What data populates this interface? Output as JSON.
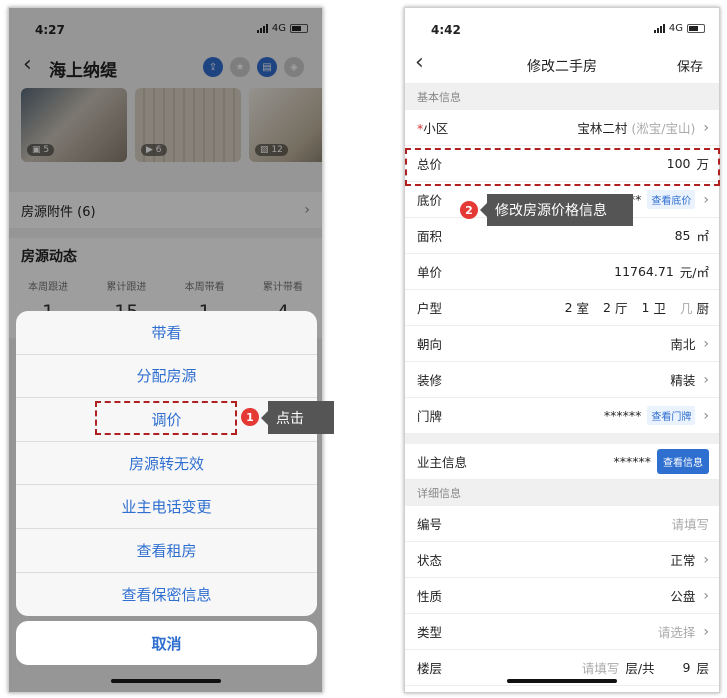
{
  "left": {
    "status": {
      "time": "4:27",
      "network": "4G"
    },
    "header": {
      "title": "海上纳缇"
    },
    "photos": [
      {
        "count": "5"
      },
      {
        "count": "6"
      },
      {
        "count": "12"
      }
    ],
    "attachments_label": "房源附件 (6)",
    "dynamics": {
      "title": "房源动态",
      "stats": [
        {
          "label": "本周跟进",
          "value": "1"
        },
        {
          "label": "累计跟进",
          "value": "15"
        },
        {
          "label": "本周带看",
          "value": "1"
        },
        {
          "label": "累计带看",
          "value": "4"
        }
      ]
    },
    "sheet_options": [
      "带看",
      "分配房源",
      "调价",
      "房源转无效",
      "业主电话变更",
      "查看租房",
      "查看保密信息"
    ],
    "cancel_label": "取消",
    "annotation": {
      "step": "1",
      "text": "点击"
    }
  },
  "right": {
    "status": {
      "time": "4:42",
      "network": "4G"
    },
    "header": {
      "title": "修改二手房",
      "save_label": "保存"
    },
    "sections": {
      "basic": "基本信息",
      "detail": "详细信息"
    },
    "fields": {
      "community": {
        "label": "小区",
        "value": "宝林二村",
        "note": "(淞宝/宝山)"
      },
      "total_price": {
        "label": "总价",
        "value": "100",
        "unit": "万"
      },
      "floor_price": {
        "label": "底价",
        "value": "******",
        "link": "查看底价"
      },
      "area": {
        "label": "面积",
        "value": "85",
        "unit": "㎡"
      },
      "unit_price": {
        "label": "单价",
        "value": "11764.71",
        "unit": "元/㎡"
      },
      "layout": {
        "label": "户型",
        "rooms": "2",
        "rooms_unit": "室",
        "halls": "2",
        "halls_unit": "厅",
        "baths": "1",
        "baths_unit": "卫",
        "kitchen_unit": "厨",
        "kitchen_ph": "几"
      },
      "orientation": {
        "label": "朝向",
        "value": "南北"
      },
      "decoration": {
        "label": "装修",
        "value": "精装"
      },
      "door": {
        "label": "门牌",
        "value": "******",
        "link": "查看门牌"
      },
      "owner": {
        "label": "业主信息",
        "value": "******",
        "button": "查看信息"
      },
      "code": {
        "label": "编号",
        "placeholder": "请填写"
      },
      "state": {
        "label": "状态",
        "value": "正常"
      },
      "nature": {
        "label": "性质",
        "value": "公盘"
      },
      "type": {
        "label": "类型",
        "placeholder": "请选择"
      },
      "floor": {
        "label": "楼层",
        "placeholder": "请填写",
        "unit1": "层/共",
        "total": "9",
        "unit2": "层"
      }
    },
    "annotation": {
      "step": "2",
      "text": "修改房源价格信息"
    }
  }
}
